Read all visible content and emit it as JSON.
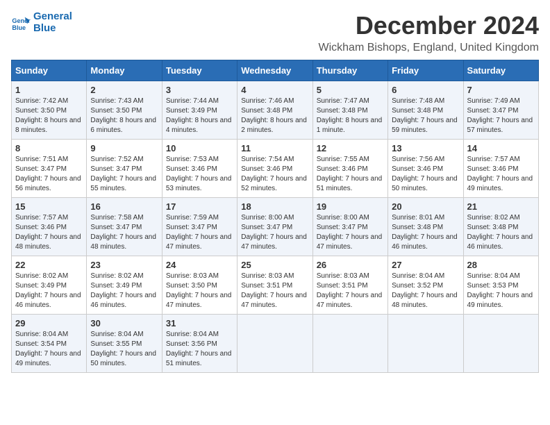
{
  "logo": {
    "line1": "General",
    "line2": "Blue"
  },
  "title": "December 2024",
  "subtitle": "Wickham Bishops, England, United Kingdom",
  "days_of_week": [
    "Sunday",
    "Monday",
    "Tuesday",
    "Wednesday",
    "Thursday",
    "Friday",
    "Saturday"
  ],
  "weeks": [
    [
      {
        "day": 1,
        "content": "Sunrise: 7:42 AM\nSunset: 3:50 PM\nDaylight: 8 hours and 8 minutes."
      },
      {
        "day": 2,
        "content": "Sunrise: 7:43 AM\nSunset: 3:50 PM\nDaylight: 8 hours and 6 minutes."
      },
      {
        "day": 3,
        "content": "Sunrise: 7:44 AM\nSunset: 3:49 PM\nDaylight: 8 hours and 4 minutes."
      },
      {
        "day": 4,
        "content": "Sunrise: 7:46 AM\nSunset: 3:48 PM\nDaylight: 8 hours and 2 minutes."
      },
      {
        "day": 5,
        "content": "Sunrise: 7:47 AM\nSunset: 3:48 PM\nDaylight: 8 hours and 1 minute."
      },
      {
        "day": 6,
        "content": "Sunrise: 7:48 AM\nSunset: 3:48 PM\nDaylight: 7 hours and 59 minutes."
      },
      {
        "day": 7,
        "content": "Sunrise: 7:49 AM\nSunset: 3:47 PM\nDaylight: 7 hours and 57 minutes."
      }
    ],
    [
      {
        "day": 8,
        "content": "Sunrise: 7:51 AM\nSunset: 3:47 PM\nDaylight: 7 hours and 56 minutes."
      },
      {
        "day": 9,
        "content": "Sunrise: 7:52 AM\nSunset: 3:47 PM\nDaylight: 7 hours and 55 minutes."
      },
      {
        "day": 10,
        "content": "Sunrise: 7:53 AM\nSunset: 3:46 PM\nDaylight: 7 hours and 53 minutes."
      },
      {
        "day": 11,
        "content": "Sunrise: 7:54 AM\nSunset: 3:46 PM\nDaylight: 7 hours and 52 minutes."
      },
      {
        "day": 12,
        "content": "Sunrise: 7:55 AM\nSunset: 3:46 PM\nDaylight: 7 hours and 51 minutes."
      },
      {
        "day": 13,
        "content": "Sunrise: 7:56 AM\nSunset: 3:46 PM\nDaylight: 7 hours and 50 minutes."
      },
      {
        "day": 14,
        "content": "Sunrise: 7:57 AM\nSunset: 3:46 PM\nDaylight: 7 hours and 49 minutes."
      }
    ],
    [
      {
        "day": 15,
        "content": "Sunrise: 7:57 AM\nSunset: 3:46 PM\nDaylight: 7 hours and 48 minutes."
      },
      {
        "day": 16,
        "content": "Sunrise: 7:58 AM\nSunset: 3:47 PM\nDaylight: 7 hours and 48 minutes."
      },
      {
        "day": 17,
        "content": "Sunrise: 7:59 AM\nSunset: 3:47 PM\nDaylight: 7 hours and 47 minutes."
      },
      {
        "day": 18,
        "content": "Sunrise: 8:00 AM\nSunset: 3:47 PM\nDaylight: 7 hours and 47 minutes."
      },
      {
        "day": 19,
        "content": "Sunrise: 8:00 AM\nSunset: 3:47 PM\nDaylight: 7 hours and 47 minutes."
      },
      {
        "day": 20,
        "content": "Sunrise: 8:01 AM\nSunset: 3:48 PM\nDaylight: 7 hours and 46 minutes."
      },
      {
        "day": 21,
        "content": "Sunrise: 8:02 AM\nSunset: 3:48 PM\nDaylight: 7 hours and 46 minutes."
      }
    ],
    [
      {
        "day": 22,
        "content": "Sunrise: 8:02 AM\nSunset: 3:49 PM\nDaylight: 7 hours and 46 minutes."
      },
      {
        "day": 23,
        "content": "Sunrise: 8:02 AM\nSunset: 3:49 PM\nDaylight: 7 hours and 46 minutes."
      },
      {
        "day": 24,
        "content": "Sunrise: 8:03 AM\nSunset: 3:50 PM\nDaylight: 7 hours and 47 minutes."
      },
      {
        "day": 25,
        "content": "Sunrise: 8:03 AM\nSunset: 3:51 PM\nDaylight: 7 hours and 47 minutes."
      },
      {
        "day": 26,
        "content": "Sunrise: 8:03 AM\nSunset: 3:51 PM\nDaylight: 7 hours and 47 minutes."
      },
      {
        "day": 27,
        "content": "Sunrise: 8:04 AM\nSunset: 3:52 PM\nDaylight: 7 hours and 48 minutes."
      },
      {
        "day": 28,
        "content": "Sunrise: 8:04 AM\nSunset: 3:53 PM\nDaylight: 7 hours and 49 minutes."
      }
    ],
    [
      {
        "day": 29,
        "content": "Sunrise: 8:04 AM\nSunset: 3:54 PM\nDaylight: 7 hours and 49 minutes."
      },
      {
        "day": 30,
        "content": "Sunrise: 8:04 AM\nSunset: 3:55 PM\nDaylight: 7 hours and 50 minutes."
      },
      {
        "day": 31,
        "content": "Sunrise: 8:04 AM\nSunset: 3:56 PM\nDaylight: 7 hours and 51 minutes."
      },
      {
        "day": null,
        "content": ""
      },
      {
        "day": null,
        "content": ""
      },
      {
        "day": null,
        "content": ""
      },
      {
        "day": null,
        "content": ""
      }
    ]
  ]
}
